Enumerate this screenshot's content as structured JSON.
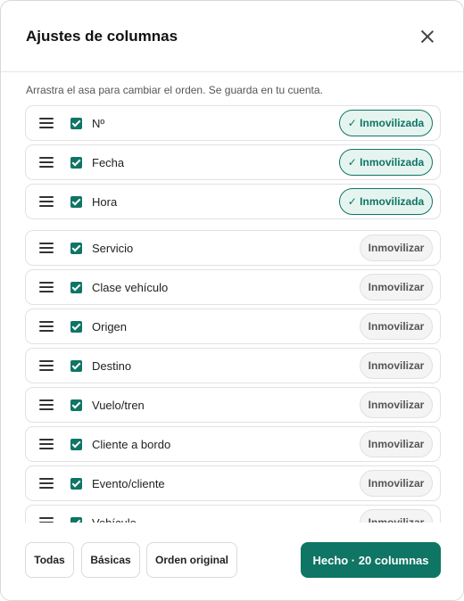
{
  "dialog": {
    "title": "Ajustes de columnas",
    "hint": "Arrastra el asa para cambiar el orden. Se guarda en tu cuenta."
  },
  "columns": [
    {
      "label": "Nº",
      "frozen": true,
      "pill": "✓ Inmovilizada"
    },
    {
      "label": "Fecha",
      "frozen": true,
      "pill": "✓ Inmovilizada"
    },
    {
      "label": "Hora",
      "frozen": true,
      "pill": "✓ Inmovilizada"
    },
    {
      "label": "Servicio",
      "frozen": false,
      "pill": "Inmovilizar"
    },
    {
      "label": "Clase vehículo",
      "frozen": false,
      "pill": "Inmovilizar"
    },
    {
      "label": "Origen",
      "frozen": false,
      "pill": "Inmovilizar"
    },
    {
      "label": "Destino",
      "frozen": false,
      "pill": "Inmovilizar"
    },
    {
      "label": "Vuelo/tren",
      "frozen": false,
      "pill": "Inmovilizar"
    },
    {
      "label": "Cliente a bordo",
      "frozen": false,
      "pill": "Inmovilizar"
    },
    {
      "label": "Evento/cliente",
      "frozen": false,
      "pill": "Inmovilizar"
    },
    {
      "label": "Vehículo",
      "frozen": false,
      "pill": "Inmovilizar"
    }
  ],
  "footer": {
    "all_label": "Todas",
    "basic_label": "Básicas",
    "original_label": "Orden original",
    "done_label": "Hecho · 20 columnas"
  },
  "colors": {
    "accent": "#0f7564",
    "frozen_bg": "#e6f4f0"
  },
  "icons": {
    "close": "close-icon",
    "handle": "drag-handle-icon",
    "checkbox": "checkbox-checked-icon"
  }
}
